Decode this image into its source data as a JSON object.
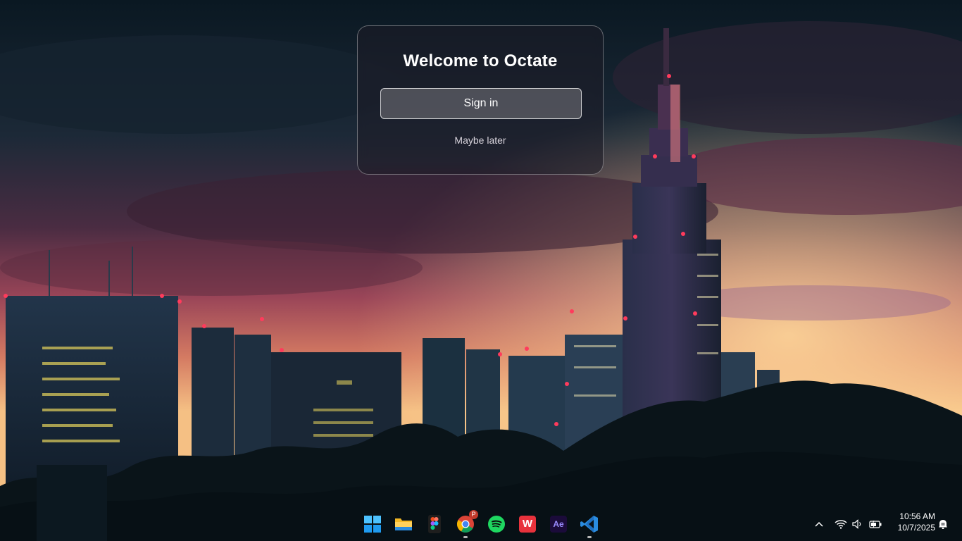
{
  "welcome_card": {
    "title": "Welcome to Octate",
    "sign_in_label": "Sign in",
    "maybe_later_label": "Maybe later"
  },
  "taskbar": {
    "apps": [
      {
        "name": "start",
        "icon": "windows-logo-icon",
        "running": false
      },
      {
        "name": "file-explorer",
        "icon": "folder-icon",
        "running": false
      },
      {
        "name": "figma",
        "icon": "figma-icon",
        "running": false
      },
      {
        "name": "chrome",
        "icon": "chrome-icon",
        "running": true,
        "badge": "P"
      },
      {
        "name": "spotify",
        "icon": "spotify-icon",
        "running": false
      },
      {
        "name": "wps-office",
        "icon": "wps-office-icon",
        "running": false,
        "label": "W"
      },
      {
        "name": "after-effects",
        "icon": "after-effects-icon",
        "running": false,
        "label": "Ae"
      },
      {
        "name": "vs-code",
        "icon": "vscode-icon",
        "running": true
      }
    ],
    "tray": {
      "icons": [
        "chevron-up-icon",
        "wifi-icon",
        "speaker-icon",
        "battery-icon",
        "notification-icon"
      ],
      "time": "10:56 AM",
      "date": "10/7/2025"
    }
  },
  "colors": {
    "sky_top": "#0b1b26",
    "sky_glow": "#f3b07a",
    "tower_light": "#ff3b5c",
    "spotify_green": "#1ed760",
    "vscode_blue": "#2a8ce0",
    "wps_red": "#e8323c",
    "ae_bg": "#1b0b3a",
    "ae_text": "#9a8cff"
  }
}
